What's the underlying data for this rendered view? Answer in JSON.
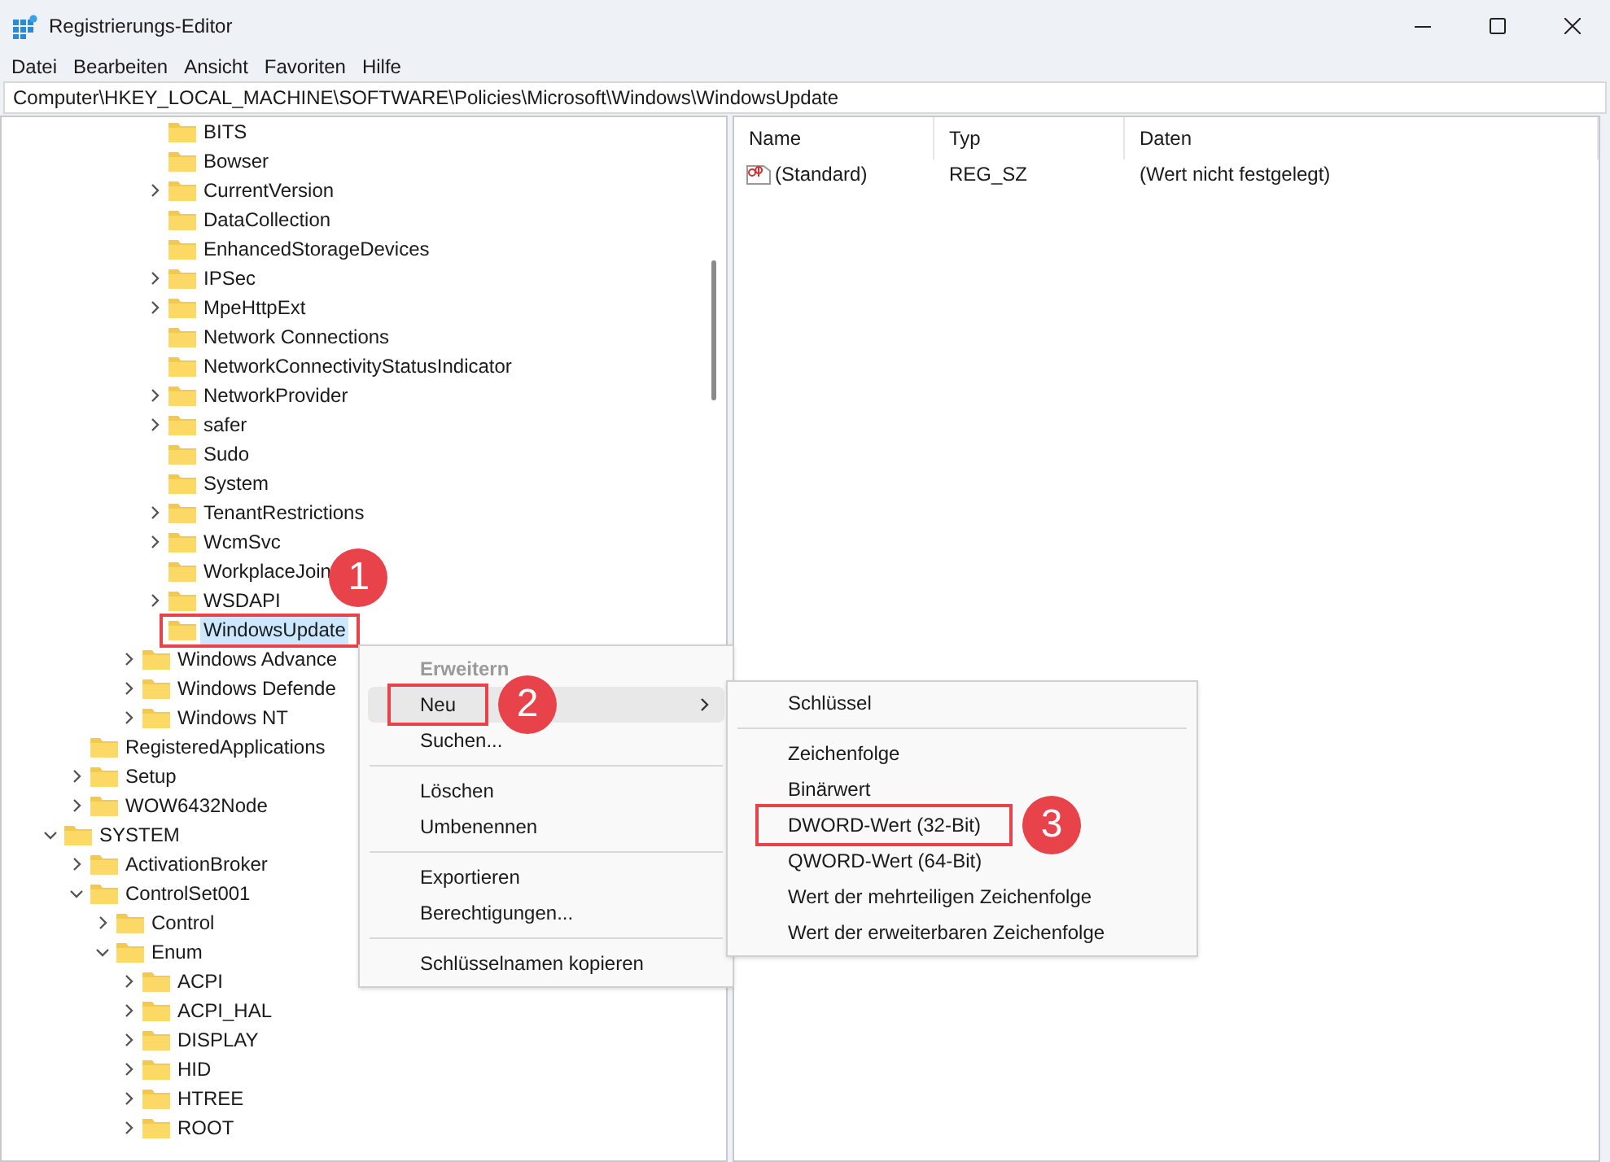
{
  "window": {
    "title": "Registrierungs-Editor"
  },
  "menu_bar": [
    "Datei",
    "Bearbeiten",
    "Ansicht",
    "Favoriten",
    "Hilfe"
  ],
  "address": "Computer\\HKEY_LOCAL_MACHINE\\SOFTWARE\\Policies\\Microsoft\\Windows\\WindowsUpdate",
  "tree": [
    {
      "children": [
        {
          "children": [
            {
              "children": [
                {
                  "children": [
                    {
                      "label": "BITS",
                      "expandable": false,
                      "selected": false
                    },
                    {
                      "label": "Bowser",
                      "expandable": false,
                      "selected": false
                    },
                    {
                      "label": "CurrentVersion",
                      "expandable": true,
                      "expanded": false,
                      "selected": false
                    },
                    {
                      "label": "DataCollection",
                      "expandable": false,
                      "selected": false
                    },
                    {
                      "label": "EnhancedStorageDevices",
                      "expandable": false,
                      "selected": false
                    },
                    {
                      "label": "IPSec",
                      "expandable": true,
                      "expanded": false,
                      "selected": false
                    },
                    {
                      "label": "MpeHttpExt",
                      "expandable": true,
                      "expanded": false,
                      "selected": false
                    },
                    {
                      "label": "Network Connections",
                      "expandable": false,
                      "selected": false
                    },
                    {
                      "label": "NetworkConnectivityStatusIndicator",
                      "expandable": false,
                      "selected": false
                    },
                    {
                      "label": "NetworkProvider",
                      "expandable": true,
                      "expanded": false,
                      "selected": false
                    },
                    {
                      "label": "safer",
                      "expandable": true,
                      "expanded": false,
                      "selected": false
                    },
                    {
                      "label": "Sudo",
                      "expandable": false,
                      "selected": false
                    },
                    {
                      "label": "System",
                      "expandable": false,
                      "selected": false
                    },
                    {
                      "label": "TenantRestrictions",
                      "expandable": true,
                      "expanded": false,
                      "selected": false
                    },
                    {
                      "label": "WcmSvc",
                      "expandable": true,
                      "expanded": false,
                      "selected": false
                    },
                    {
                      "label": "WorkplaceJoin",
                      "expandable": false,
                      "selected": false
                    },
                    {
                      "label": "WSDAPI",
                      "expandable": true,
                      "expanded": false,
                      "selected": false
                    },
                    {
                      "label": "WindowsUpdate",
                      "expandable": false,
                      "selected": true,
                      "outlined": true,
                      "callout": "1"
                    }
                  ]
                },
                {
                  "label": "Windows Advance",
                  "expandable": true,
                  "expanded": false,
                  "selected": false
                },
                {
                  "label": "Windows Defende",
                  "expandable": true,
                  "expanded": false,
                  "selected": false
                },
                {
                  "label": "Windows NT",
                  "expandable": true,
                  "expanded": false,
                  "selected": false
                }
              ]
            }
          ]
        },
        {
          "label": "RegisteredApplications",
          "expandable": false,
          "selected": false
        },
        {
          "label": "Setup",
          "expandable": true,
          "expanded": false,
          "selected": false
        },
        {
          "label": "WOW6432Node",
          "expandable": true,
          "expanded": false,
          "selected": false
        }
      ]
    },
    {
      "label": "SYSTEM",
      "expandable": true,
      "expanded": true,
      "selected": false,
      "children": [
        {
          "label": "ActivationBroker",
          "expandable": true,
          "expanded": false,
          "selected": false
        },
        {
          "label": "ControlSet001",
          "expandable": true,
          "expanded": true,
          "selected": false,
          "children": [
            {
              "label": "Control",
              "expandable": true,
              "expanded": false,
              "selected": false
            },
            {
              "label": "Enum",
              "expandable": true,
              "expanded": true,
              "selected": false,
              "children": [
                {
                  "label": "ACPI",
                  "expandable": true,
                  "expanded": false,
                  "selected": false
                },
                {
                  "label": "ACPI_HAL",
                  "expandable": true,
                  "expanded": false,
                  "selected": false
                },
                {
                  "label": "DISPLAY",
                  "expandable": true,
                  "expanded": false,
                  "selected": false
                },
                {
                  "label": "HID",
                  "expandable": true,
                  "expanded": false,
                  "selected": false
                },
                {
                  "label": "HTREE",
                  "expandable": true,
                  "expanded": false,
                  "selected": false
                },
                {
                  "label": "ROOT",
                  "expandable": true,
                  "expanded": false,
                  "selected": false
                }
              ]
            }
          ]
        }
      ]
    }
  ],
  "values_table": {
    "columns": [
      "Name",
      "Typ",
      "Daten"
    ],
    "rows": [
      {
        "name": "(Standard)",
        "type": "REG_SZ",
        "data": "(Wert nicht festgelegt)"
      }
    ]
  },
  "context_menu": [
    {
      "kind": "item",
      "label": "Erweitern",
      "disabled": true,
      "selected": false,
      "submenu": false
    },
    {
      "kind": "item",
      "label": "Neu",
      "disabled": false,
      "selected": true,
      "submenu": true,
      "outlined": true,
      "callout": "2"
    },
    {
      "kind": "item",
      "label": "Suchen...",
      "disabled": false,
      "selected": false,
      "submenu": false
    },
    {
      "kind": "separator"
    },
    {
      "kind": "item",
      "label": "Löschen",
      "disabled": false,
      "selected": false,
      "submenu": false
    },
    {
      "kind": "item",
      "label": "Umbenennen",
      "disabled": false,
      "selected": false,
      "submenu": false
    },
    {
      "kind": "separator"
    },
    {
      "kind": "item",
      "label": "Exportieren",
      "disabled": false,
      "selected": false,
      "submenu": false
    },
    {
      "kind": "item",
      "label": "Berechtigungen...",
      "disabled": false,
      "selected": false,
      "submenu": false
    },
    {
      "kind": "separator"
    },
    {
      "kind": "item",
      "label": "Schlüsselnamen kopieren",
      "disabled": false,
      "selected": false,
      "submenu": false
    }
  ],
  "submenu": [
    {
      "kind": "item",
      "label": "Schlüssel",
      "disabled": false,
      "selected": false,
      "submenu": false
    },
    {
      "kind": "separator"
    },
    {
      "kind": "item",
      "label": "Zeichenfolge",
      "disabled": false,
      "selected": false,
      "submenu": false
    },
    {
      "kind": "item",
      "label": "Binärwert",
      "disabled": false,
      "selected": false,
      "submenu": false
    },
    {
      "kind": "item",
      "label": "DWORD-Wert (32-Bit)",
      "disabled": false,
      "selected": false,
      "submenu": false,
      "outlined": true,
      "callout": "3"
    },
    {
      "kind": "item",
      "label": "QWORD-Wert (64-Bit)",
      "disabled": false,
      "selected": false,
      "submenu": false
    },
    {
      "kind": "item",
      "label": "Wert der mehrteiligen Zeichenfolge",
      "disabled": false,
      "selected": false,
      "submenu": false
    },
    {
      "kind": "item",
      "label": "Wert der erweiterbaren Zeichenfolge",
      "disabled": false,
      "selected": false,
      "submenu": false
    }
  ]
}
